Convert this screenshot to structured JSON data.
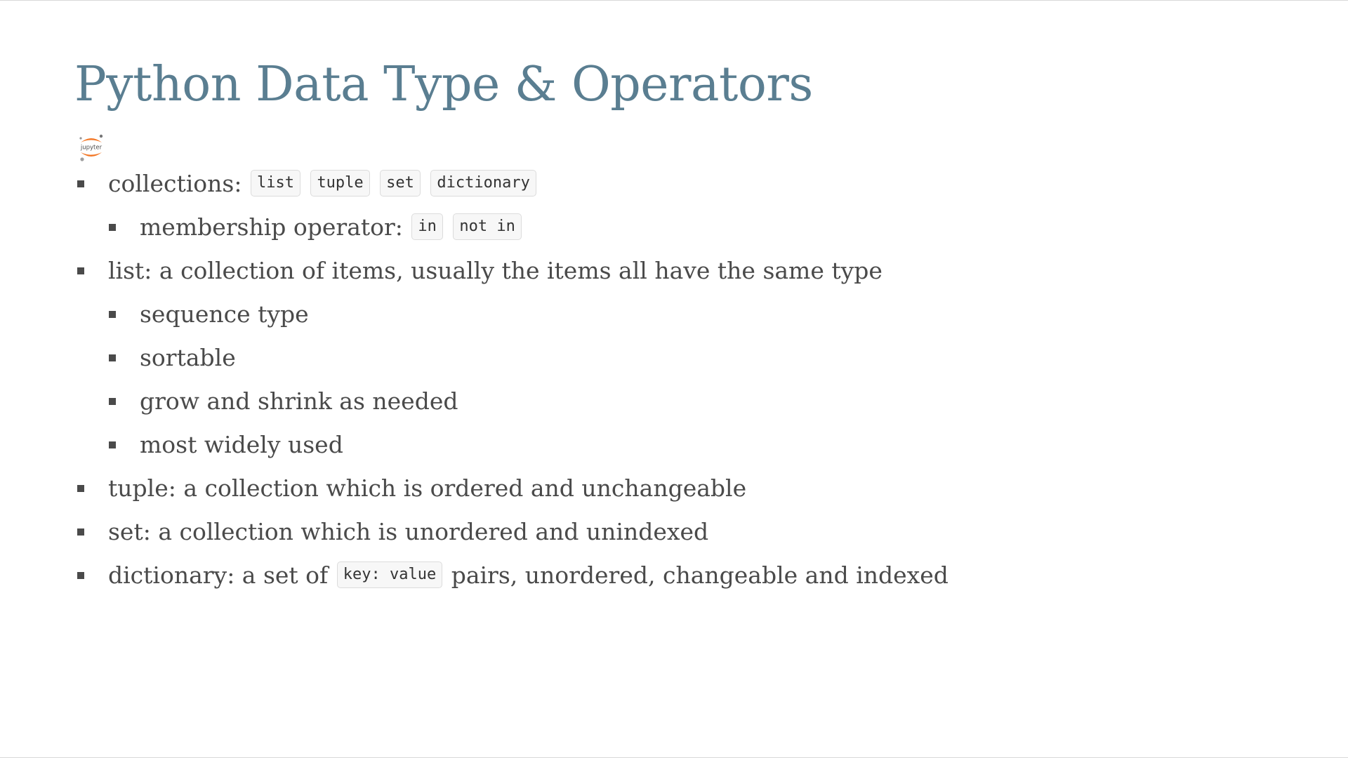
{
  "slide": {
    "title": "Python Data Type & Operators",
    "logo": {
      "icon": "jupyter-logo-icon",
      "text": "jupyter"
    },
    "colors": {
      "title": "#5a7e91",
      "text": "#4a4a4a",
      "logo_orange": "#f37726"
    }
  },
  "items": [
    {
      "text": "collections: ",
      "codes": [
        "list",
        "tuple",
        "set",
        "dictionary"
      ],
      "children": [
        {
          "text": "membership operator: ",
          "codes": [
            "in",
            "not in"
          ]
        }
      ]
    },
    {
      "text": "list: a collection of items, usually the items all have the same type",
      "children": [
        {
          "text": "sequence type"
        },
        {
          "text": "sortable"
        },
        {
          "text": "grow and shrink as needed"
        },
        {
          "text": "most widely used"
        }
      ]
    },
    {
      "text": "tuple: a collection which is ordered and unchangeable"
    },
    {
      "text": "set: a collection which is unordered and unindexed"
    },
    {
      "text": "dictionary: a set of ",
      "code": "key: value",
      "after": " pairs, unordered, changeable and indexed"
    }
  ]
}
